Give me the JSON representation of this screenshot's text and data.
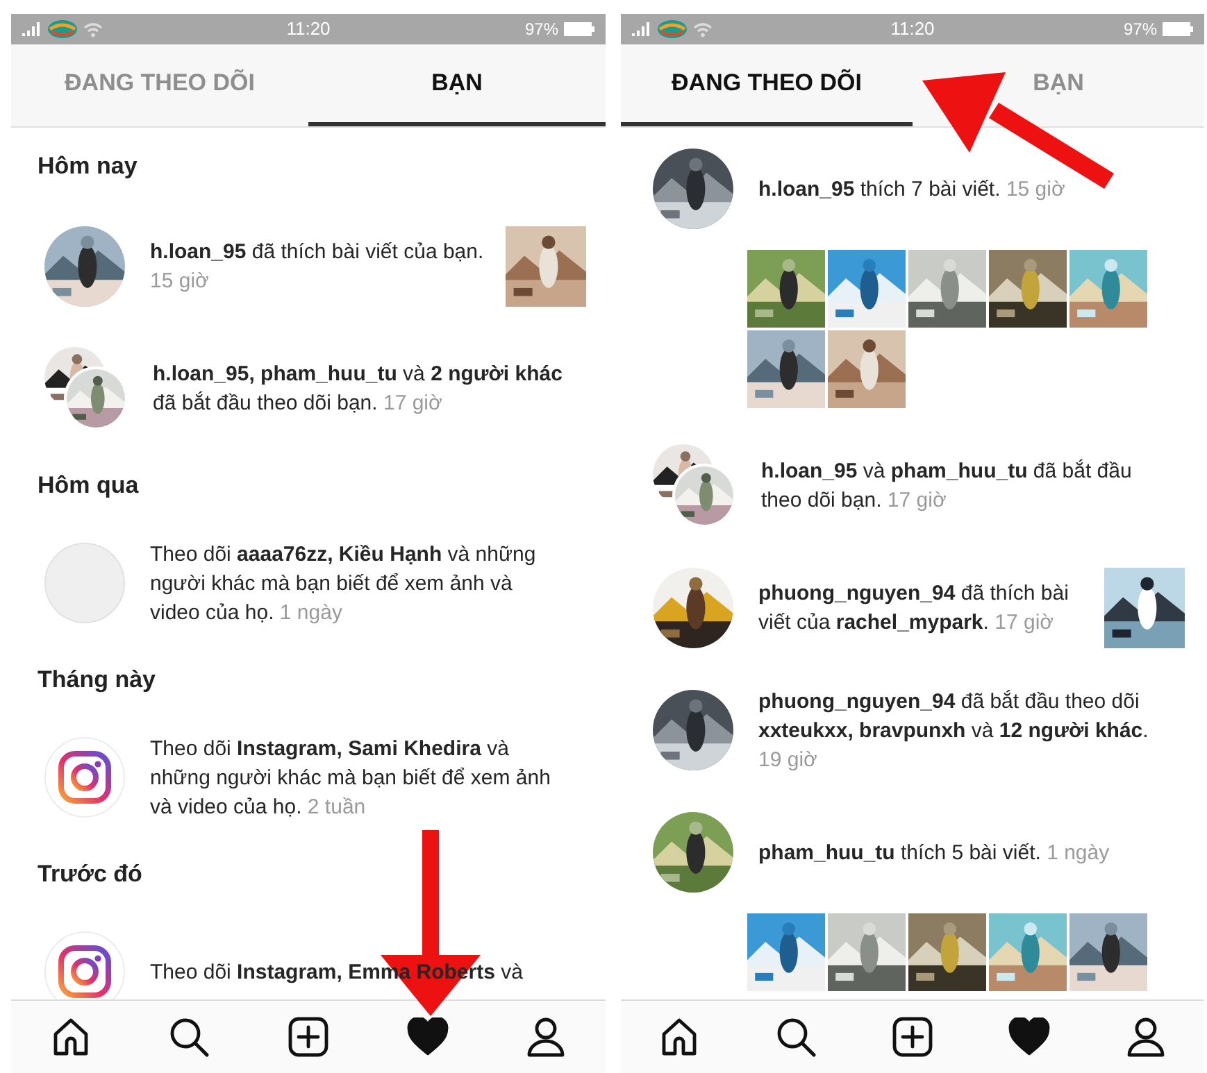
{
  "panels": [
    {
      "status_bar": {
        "time": "11:20",
        "battery": "97%"
      },
      "tabs": [
        {
          "label": "ĐANG THEO DÕI",
          "selected": false
        },
        {
          "label": "BẠN",
          "selected": true
        }
      ],
      "feed": [
        {
          "kind": "header",
          "title": "Hôm nay"
        },
        {
          "kind": "notification",
          "text": "**h.loan_95** đã thích bài viết của bạn.",
          "time": "15 giờ"
        },
        {
          "kind": "notification",
          "avatar": {
            "kind": "double"
          },
          "text": "**h.loan_95, pham_huu_tu** và **2 người khác** đã bắt đầu theo dõi bạn.",
          "time": "17 giờ"
        },
        {
          "kind": "header",
          "title": "Hôm qua"
        },
        {
          "kind": "notification",
          "avatar": {
            "kind": "empty"
          },
          "text": "Theo dõi **aaaa76zz, Kiều Hạnh** và những người khác mà bạn biết để xem ảnh và video của họ.",
          "time": "1 ngày"
        },
        {
          "kind": "header",
          "title": "Tháng này"
        },
        {
          "kind": "notification",
          "avatar": {
            "kind": "logo"
          },
          "text": "Theo dõi **Instagram, Sami Khedira** và những người khác mà bạn biết để xem ảnh và video của họ.",
          "time": "2 tuần"
        },
        {
          "kind": "header",
          "title": "Trước đó"
        },
        {
          "kind": "notification",
          "avatar": {
            "kind": "logo"
          },
          "text": "Theo dõi **Instagram, Emma Roberts** và"
        }
      ],
      "nav": [
        {
          "kind": "home",
          "selected": false
        },
        {
          "kind": "search",
          "selected": false
        },
        {
          "kind": "add",
          "selected": false
        },
        {
          "kind": "activity",
          "selected": true
        },
        {
          "kind": "profile",
          "selected": false
        }
      ]
    },
    {
      "status_bar": {
        "time": "11:20",
        "battery": "97%"
      },
      "tabs": [
        {
          "label": "ĐANG THEO DÕI",
          "selected": true
        },
        {
          "label": "BẠN",
          "selected": false
        }
      ],
      "feed": [
        {
          "kind": "notification",
          "text": "**h.loan_95** thích 7 bài viết.",
          "time": "15 giờ"
        },
        {
          "kind": "notification",
          "avatar": {
            "kind": "double"
          },
          "text": "**h.loan_95** và **pham_huu_tu** đã bắt đầu theo dõi bạn.",
          "time": "17 giờ"
        },
        {
          "kind": "notification",
          "text": "**phuong_nguyen_94** đã thích bài viết của **rachel_mypark**.",
          "time": "17 giờ"
        },
        {
          "kind": "notification",
          "text": "**phuong_nguyen_94** đã bắt đầu theo dõi **xxteukxx, bravpunxh** và **12 người khác**.",
          "time": "19 giờ"
        },
        {
          "kind": "notification",
          "text": "**pham_huu_tu** thích 5 bài viết.",
          "time": "1 ngày"
        }
      ],
      "nav": [
        {
          "kind": "home",
          "selected": false
        },
        {
          "kind": "search",
          "selected": false
        },
        {
          "kind": "add",
          "selected": false
        },
        {
          "kind": "activity",
          "selected": true
        },
        {
          "kind": "profile",
          "selected": false
        }
      ]
    }
  ],
  "annotations": [
    {
      "kind": "arrow"
    },
    {
      "kind": "arrow"
    }
  ]
}
